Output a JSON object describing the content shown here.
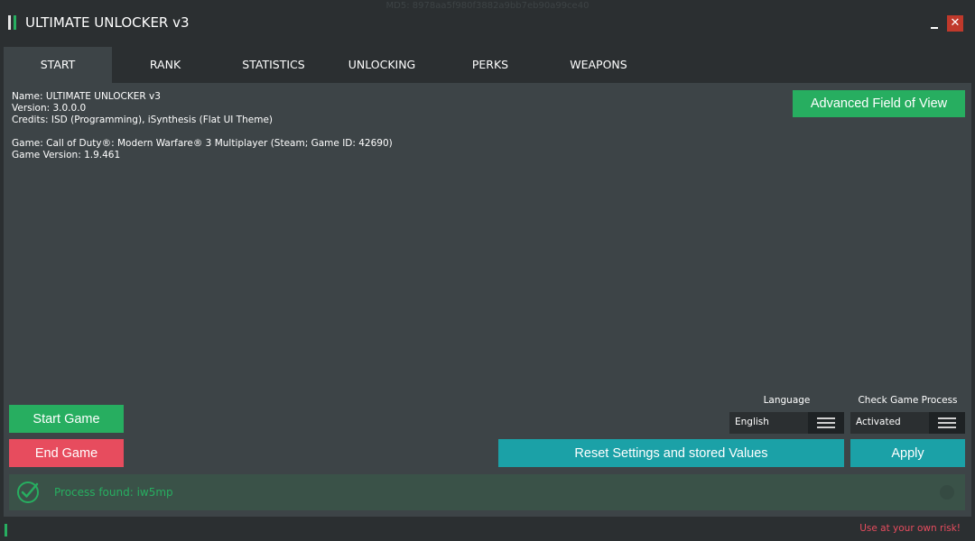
{
  "window": {
    "title": "ULTIMATE UNLOCKER v3",
    "md5": "MD5: 8978aa5f980f3882a9bb7eb90a99ce40",
    "minimize_icon": "minimize-icon",
    "close_icon": "close-icon",
    "close_glyph": "✕"
  },
  "tabs": [
    {
      "label": "START",
      "active": true
    },
    {
      "label": "RANK"
    },
    {
      "label": "STATISTICS"
    },
    {
      "label": "UNLOCKING"
    },
    {
      "label": "PERKS"
    },
    {
      "label": "WEAPONS"
    }
  ],
  "info": {
    "name": "Name: ULTIMATE UNLOCKER v3",
    "version": "Version: 3.0.0.0",
    "credits": "Credits: ISD (Programming), iSynthesis (Flat UI Theme)",
    "game": "Game: Call of Duty®: Modern Warfare® 3 Multiplayer (Steam; Game ID: 42690)",
    "game_version": "Game Version: 1.9.461"
  },
  "buttons": {
    "advanced_fov": "Advanced Field of View",
    "start_game": "Start Game",
    "end_game": "End Game",
    "reset": "Reset Settings and stored Values",
    "apply": "Apply"
  },
  "language": {
    "label": "Language",
    "value": "English",
    "icon": "menu-icon"
  },
  "check_process": {
    "label": "Check Game Process",
    "value": "Activated",
    "icon": "menu-icon"
  },
  "status": {
    "message": "Process found: iw5mp",
    "icon": "check-circle-icon"
  },
  "footer": {
    "warning": "Use at your own risk!"
  },
  "colors": {
    "background": "#2b2f31",
    "panel": "#3d4447",
    "green": "#27ae60",
    "red": "#e74c5e",
    "teal": "#1ba1a7",
    "close_red": "#c0392b"
  }
}
